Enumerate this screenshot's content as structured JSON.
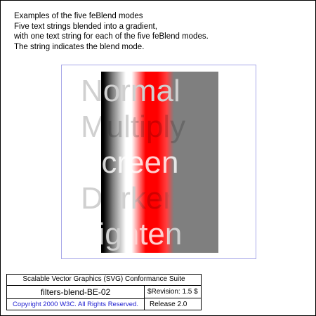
{
  "description": {
    "lines": [
      "Examples of the five feBlend modes",
      "Five text strings blended into a gradient,",
      "with one text string for each of the five feBlend modes.",
      "The string indicates the blend mode."
    ]
  },
  "blend_strings": [
    "Normal",
    "Multiply",
    "Screen",
    "Darken",
    "Lighten"
  ],
  "colors": {
    "stage_border": "#a8a8e8",
    "text": "#d0d0d0",
    "gradient_red": "#ff0000",
    "gradient_gray": "#7f7f7f",
    "copyright_link": "#2020d0"
  },
  "footer": {
    "suite_title": "Scalable Vector Graphics (SVG) Conformance Suite",
    "test_name": "filters-blend-BE-02",
    "revision": "$Revision: 1.5 $",
    "copyright": "Copyright 2000 W3C. All Rights Reserved.",
    "release": "Release 2.0"
  }
}
